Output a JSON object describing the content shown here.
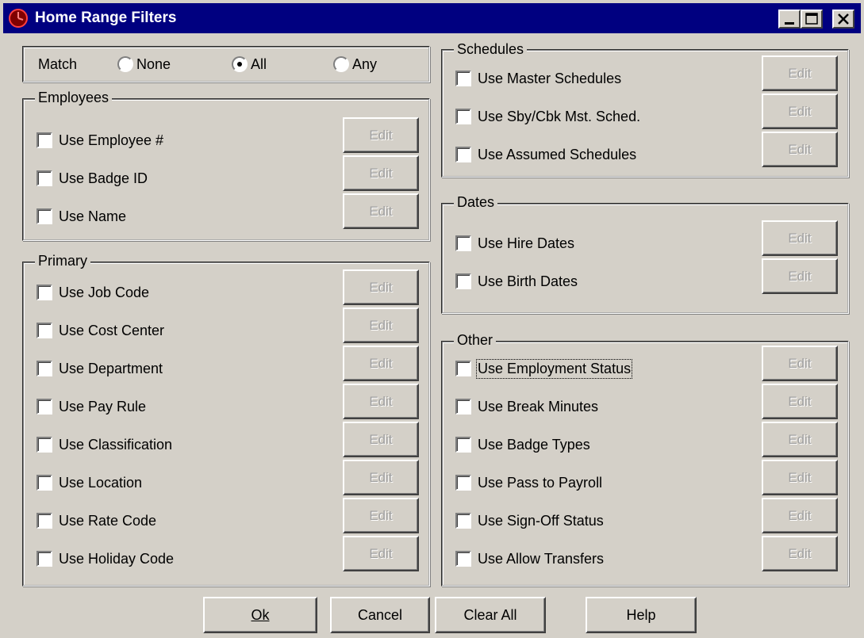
{
  "window": {
    "title": "Home Range Filters"
  },
  "match": {
    "label": "Match",
    "options": [
      "None",
      "All",
      "Any"
    ],
    "selected": "All"
  },
  "employees": {
    "title": "Employees",
    "items": [
      "Use Employee #",
      "Use Badge ID",
      "Use Name"
    ]
  },
  "primary": {
    "title": "Primary",
    "items": [
      "Use Job Code",
      "Use Cost Center",
      "Use Department",
      "Use Pay Rule",
      "Use Classification",
      "Use Location",
      "Use Rate Code",
      "Use Holiday Code"
    ]
  },
  "schedules": {
    "title": "Schedules",
    "items": [
      "Use Master Schedules",
      "Use Sby/Cbk Mst. Sched.",
      "Use Assumed Schedules"
    ]
  },
  "dates": {
    "title": "Dates",
    "items": [
      "Use Hire Dates",
      "Use Birth Dates"
    ]
  },
  "other": {
    "title": "Other",
    "items": [
      "Use Employment Status",
      "Use Break Minutes",
      "Use Badge Types",
      "Use Pass to Payroll",
      "Use Sign-Off Status",
      "Use Allow Transfers"
    ]
  },
  "edit_label": "Edit",
  "buttons": {
    "ok": "Ok",
    "cancel": "Cancel",
    "clear_all": "Clear All",
    "help": "Help"
  }
}
